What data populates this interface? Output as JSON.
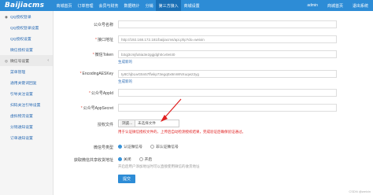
{
  "app": {
    "logo": "Baijiacms"
  },
  "nav": [
    {
      "label": "商城首页",
      "active": false
    },
    {
      "label": "订单管理",
      "active": false
    },
    {
      "label": "会员与财务",
      "active": false
    },
    {
      "label": "数据统计",
      "active": false
    },
    {
      "label": "分销",
      "active": false
    },
    {
      "label": "第三方接入",
      "active": true
    },
    {
      "label": "商城设置",
      "active": false
    }
  ],
  "top_right": {
    "user": "admin",
    "home": "商城首页",
    "logout": "退出系统"
  },
  "sidebar": {
    "items": [
      {
        "label": "QQ授权登录",
        "icon": "qq-icon",
        "kind": "sub"
      },
      {
        "label": "QQ授权登录设置",
        "icon": "",
        "kind": "sub"
      },
      {
        "label": "QQ授权设置",
        "icon": "",
        "kind": "sub"
      },
      {
        "label": "微信授权设置",
        "icon": "",
        "kind": "sub"
      },
      {
        "label": "微信号设置",
        "icon": "wechat-icon",
        "kind": "group"
      },
      {
        "label": "菜单管理",
        "icon": "",
        "kind": "sub"
      },
      {
        "label": "通用关键词回复",
        "icon": "",
        "kind": "sub"
      },
      {
        "label": "引导关注设置",
        "icon": "",
        "kind": "sub"
      },
      {
        "label": "扫码关注引导设置",
        "icon": "",
        "kind": "sub"
      },
      {
        "label": "虚拟物流设置",
        "icon": "",
        "kind": "sub"
      },
      {
        "label": "分销通知设置",
        "icon": "",
        "kind": "sub"
      },
      {
        "label": "订单通知设置",
        "icon": "",
        "kind": "sub"
      }
    ]
  },
  "form": {
    "account_name": {
      "label": "公众号名称",
      "required": false,
      "value": ""
    },
    "api_url": {
      "label": "接口地址",
      "required": true,
      "value": "http://192.168.172.181/baijiacms/api.php?do=weixin"
    },
    "token": {
      "label": "微信Token",
      "required": true,
      "value": "b3qj3cmjfu5ia3e2ggjdgh0cv0et40",
      "link": "生成新的"
    },
    "aes_key": {
      "label": "EncodingAESKey",
      "required": true,
      "value": "ty8ChjbLwG5n57ffwkp73egq0x8mWNXuqw22yg",
      "link": "生成新的"
    },
    "appid": {
      "label": "公众号AppId",
      "required": true,
      "value": ""
    },
    "appsecret": {
      "label": "公众号AppSecret",
      "required": true,
      "value": ""
    },
    "auth_file": {
      "label": "授权文件",
      "button": "浏览...",
      "filename": "未选择文件",
      "hint": "用于认证微信授权文件的，上传后自动检测授权结果，完成验证后确保验证通过。"
    },
    "account_type": {
      "label": "微信号类型",
      "options": [
        "认证微信号",
        "非认证微信号"
      ],
      "selected": 0
    },
    "share_link": {
      "label": "获取微信共享收货地址",
      "options": [
        "关闭",
        "开启"
      ],
      "selected": 0,
      "hint": "开启后用户添加地址时可以直接使用微信的收货地址"
    },
    "submit": "提交"
  },
  "watermark": "CSDN @weixin"
}
